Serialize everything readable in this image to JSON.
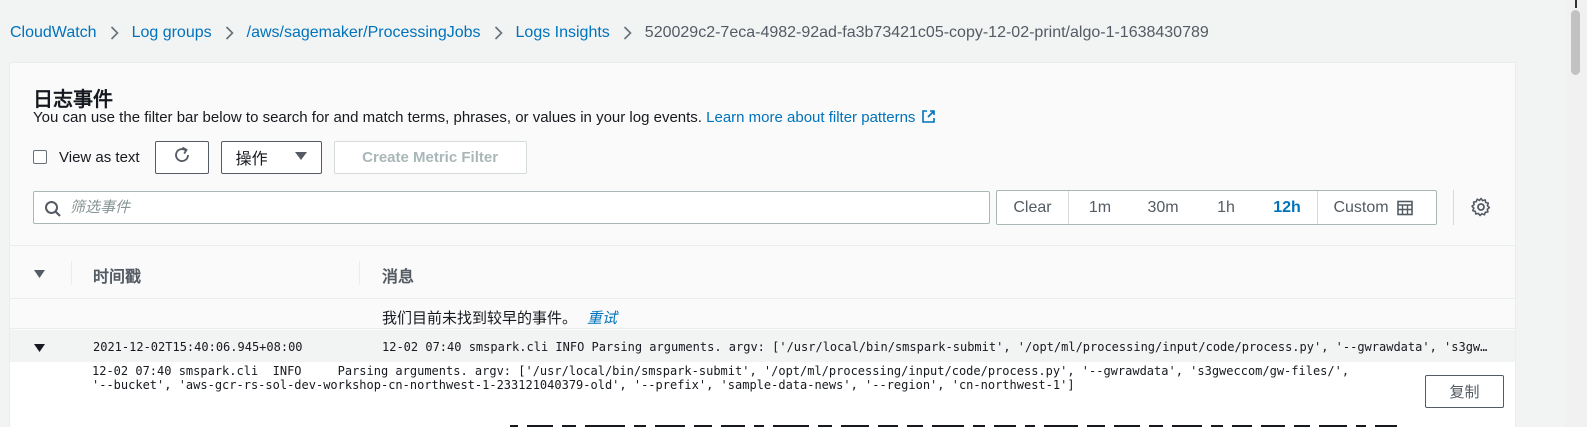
{
  "breadcrumb": {
    "items": [
      "CloudWatch",
      "Log groups",
      "/aws/sagemaker/ProcessingJobs",
      "Logs Insights"
    ],
    "current": "520029c2-7eca-4982-92ad-fa3b73421c05-copy-12-02-print/algo-1-1638430789"
  },
  "panel": {
    "title": "日志事件",
    "description": "You can use the filter bar below to search for and match terms, phrases, or values in your log events.",
    "learn_more": "Learn more about filter patterns"
  },
  "controls": {
    "view_as_text": "View as text",
    "view_as_text_checked": false,
    "actions_label": "操作",
    "create_metric_filter": "Create Metric Filter"
  },
  "search": {
    "placeholder": "筛选事件",
    "value": ""
  },
  "time_range": {
    "clear": "Clear",
    "options": [
      "1m",
      "30m",
      "1h",
      "12h"
    ],
    "selected": "12h",
    "custom": "Custom"
  },
  "table": {
    "col_timestamp": "时间戳",
    "col_message": "消息",
    "notice": "我们目前未找到较早的事件。",
    "retry": "重试"
  },
  "events": [
    {
      "timestamp": "2021-12-02T15:40:06.945+08:00",
      "message": "12-02 07:40 smspark.cli INFO Parsing arguments. argv: ['/usr/local/bin/smspark-submit', '/opt/ml/processing/input/code/process.py', '--gwrawdata', 's3gweccom/gw-files/', '--bucket', 'aws-gcr-rs-sol-dev-workshop-cn-northwest-1-233121040379-old', '--prefix', 'sample-data-news', '--region', 'cn-northwest-1']",
      "expanded_text": "12-02 07:40 smspark.cli  INFO     Parsing arguments. argv: ['/usr/local/bin/smspark-submit', '/opt/ml/processing/input/code/process.py', '--gwrawdata', 's3gweccom/gw-files/',\n'--bucket', 'aws-gcr-rs-sol-dev-workshop-cn-northwest-1-233121040379-old', '--prefix', 'sample-data-news', '--region', 'cn-northwest-1']",
      "copy_label": "复制"
    }
  ],
  "colors": {
    "link": "#0073bb",
    "text": "#16191f",
    "muted": "#545b64",
    "disabled": "#aab7b8"
  }
}
